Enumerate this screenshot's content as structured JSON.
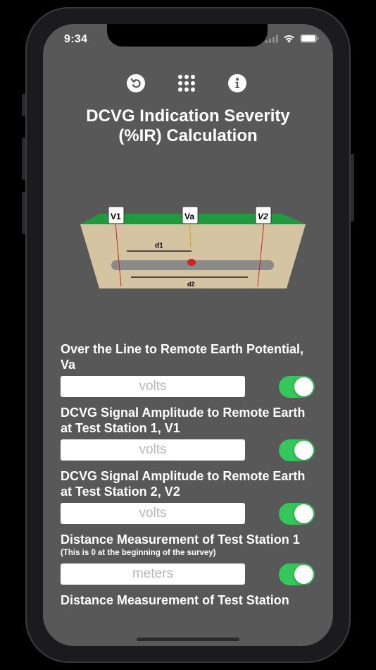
{
  "status": {
    "time": "9:34"
  },
  "toolbar": {
    "undo_icon": "undo-circle-icon",
    "menu_icon": "grid-icon",
    "info_icon": "info-circle-icon"
  },
  "title": {
    "line1": "DCVG Indication Severity",
    "line2": "(%IR) Calculation"
  },
  "diagram": {
    "labels": {
      "v1": "V1",
      "va": "Va",
      "v2": "V2",
      "d1": "d1",
      "d2": "d2"
    },
    "colors": {
      "grass": "#1f9a3c",
      "soil": "#d5c4a1",
      "pipe": "#8a8a8a",
      "defect": "#d42020"
    }
  },
  "form": {
    "fields": [
      {
        "label": "Over the Line to Remote Earth Potential, Va",
        "note": "",
        "placeholder": "volts",
        "toggle_on": true
      },
      {
        "label": "DCVG Signal Amplitude to Remote Earth at Test Station 1, V1",
        "note": "",
        "placeholder": "volts",
        "toggle_on": true
      },
      {
        "label": "DCVG Signal Amplitude to Remote Earth at Test Station 2, V2",
        "note": "",
        "placeholder": "volts",
        "toggle_on": true
      },
      {
        "label": "Distance Measurement of Test Station 1",
        "note": "(This is 0 at the beginning of the survey)",
        "placeholder": "meters",
        "toggle_on": true
      }
    ],
    "next_label": "Distance Measurement of Test Station"
  },
  "colors": {
    "background": "#585858",
    "toggle_on": "#34c759"
  }
}
